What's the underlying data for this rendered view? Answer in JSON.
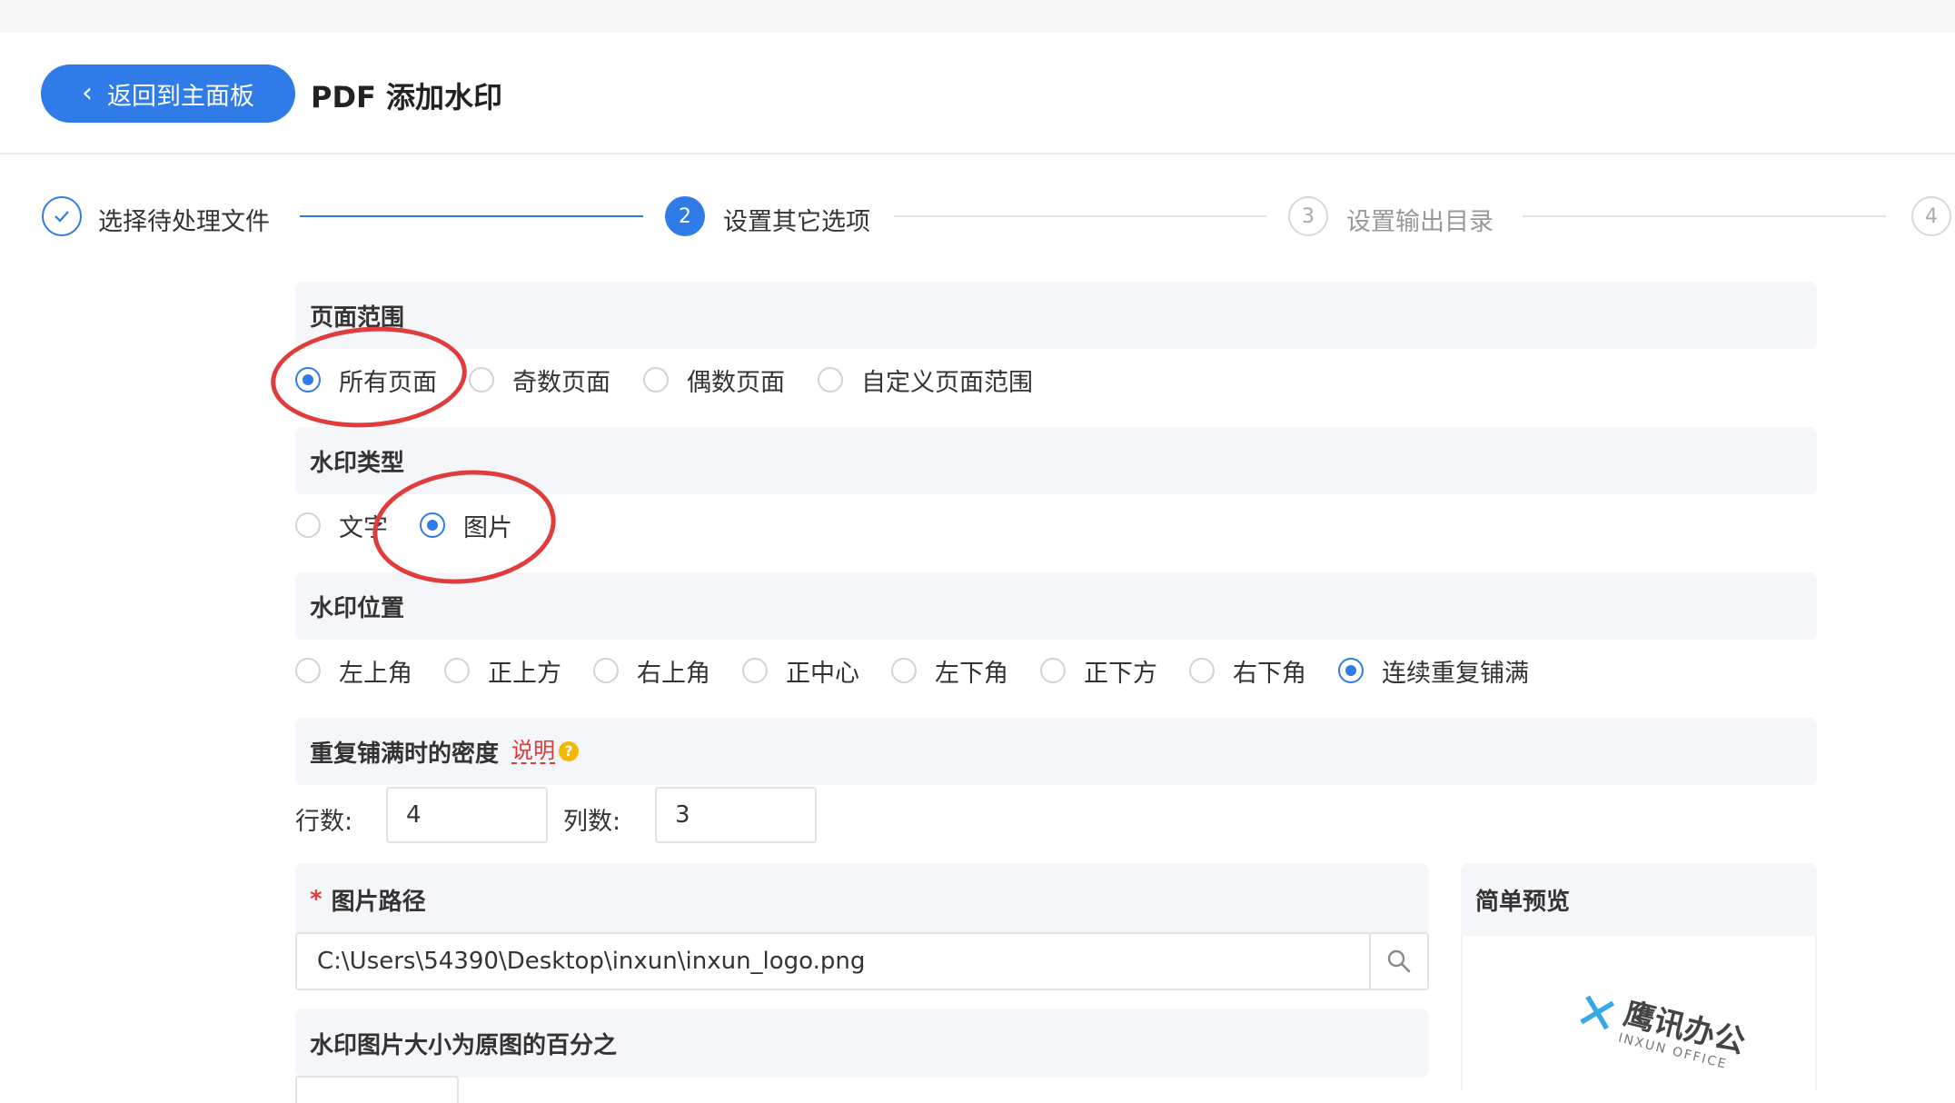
{
  "header": {
    "back_label": "返回到主面板",
    "title": "PDF 添加水印"
  },
  "steps": [
    {
      "number": "✓",
      "label": "选择待处理文件",
      "state": "done"
    },
    {
      "number": "2",
      "label": "设置其它选项",
      "state": "active"
    },
    {
      "number": "3",
      "label": "设置输出目录",
      "state": "todo"
    },
    {
      "number": "4",
      "label": "",
      "state": "todo"
    }
  ],
  "page_range": {
    "title": "页面范围",
    "options": [
      "所有页面",
      "奇数页面",
      "偶数页面",
      "自定义页面范围"
    ],
    "selected": "所有页面"
  },
  "watermark_type": {
    "title": "水印类型",
    "options": [
      "文字",
      "图片"
    ],
    "selected": "图片"
  },
  "watermark_position": {
    "title": "水印位置",
    "options": [
      "左上角",
      "正上方",
      "右上角",
      "正中心",
      "左下角",
      "正下方",
      "右下角",
      "连续重复铺满"
    ],
    "selected": "连续重复铺满"
  },
  "density": {
    "title": "重复铺满时的密度",
    "help_link": "说明",
    "help_icon": "?",
    "rows_label": "行数:",
    "rows_value": "4",
    "cols_label": "列数:",
    "cols_value": "3"
  },
  "image_path": {
    "required_mark": "*",
    "title": "图片路径",
    "value": "C:\\Users\\54390\\Desktop\\inxun\\inxun_logo.png",
    "search_icon": "search-icon"
  },
  "preview": {
    "title": "简单预览",
    "logo_cn": "鹰讯办公",
    "logo_en": "INXUN OFFICE"
  },
  "image_size": {
    "title": "水印图片大小为原图的百分之"
  },
  "colors": {
    "primary": "#2f7ce8",
    "annotation": "#e03c3c",
    "section_bg": "#f5f6fa"
  }
}
